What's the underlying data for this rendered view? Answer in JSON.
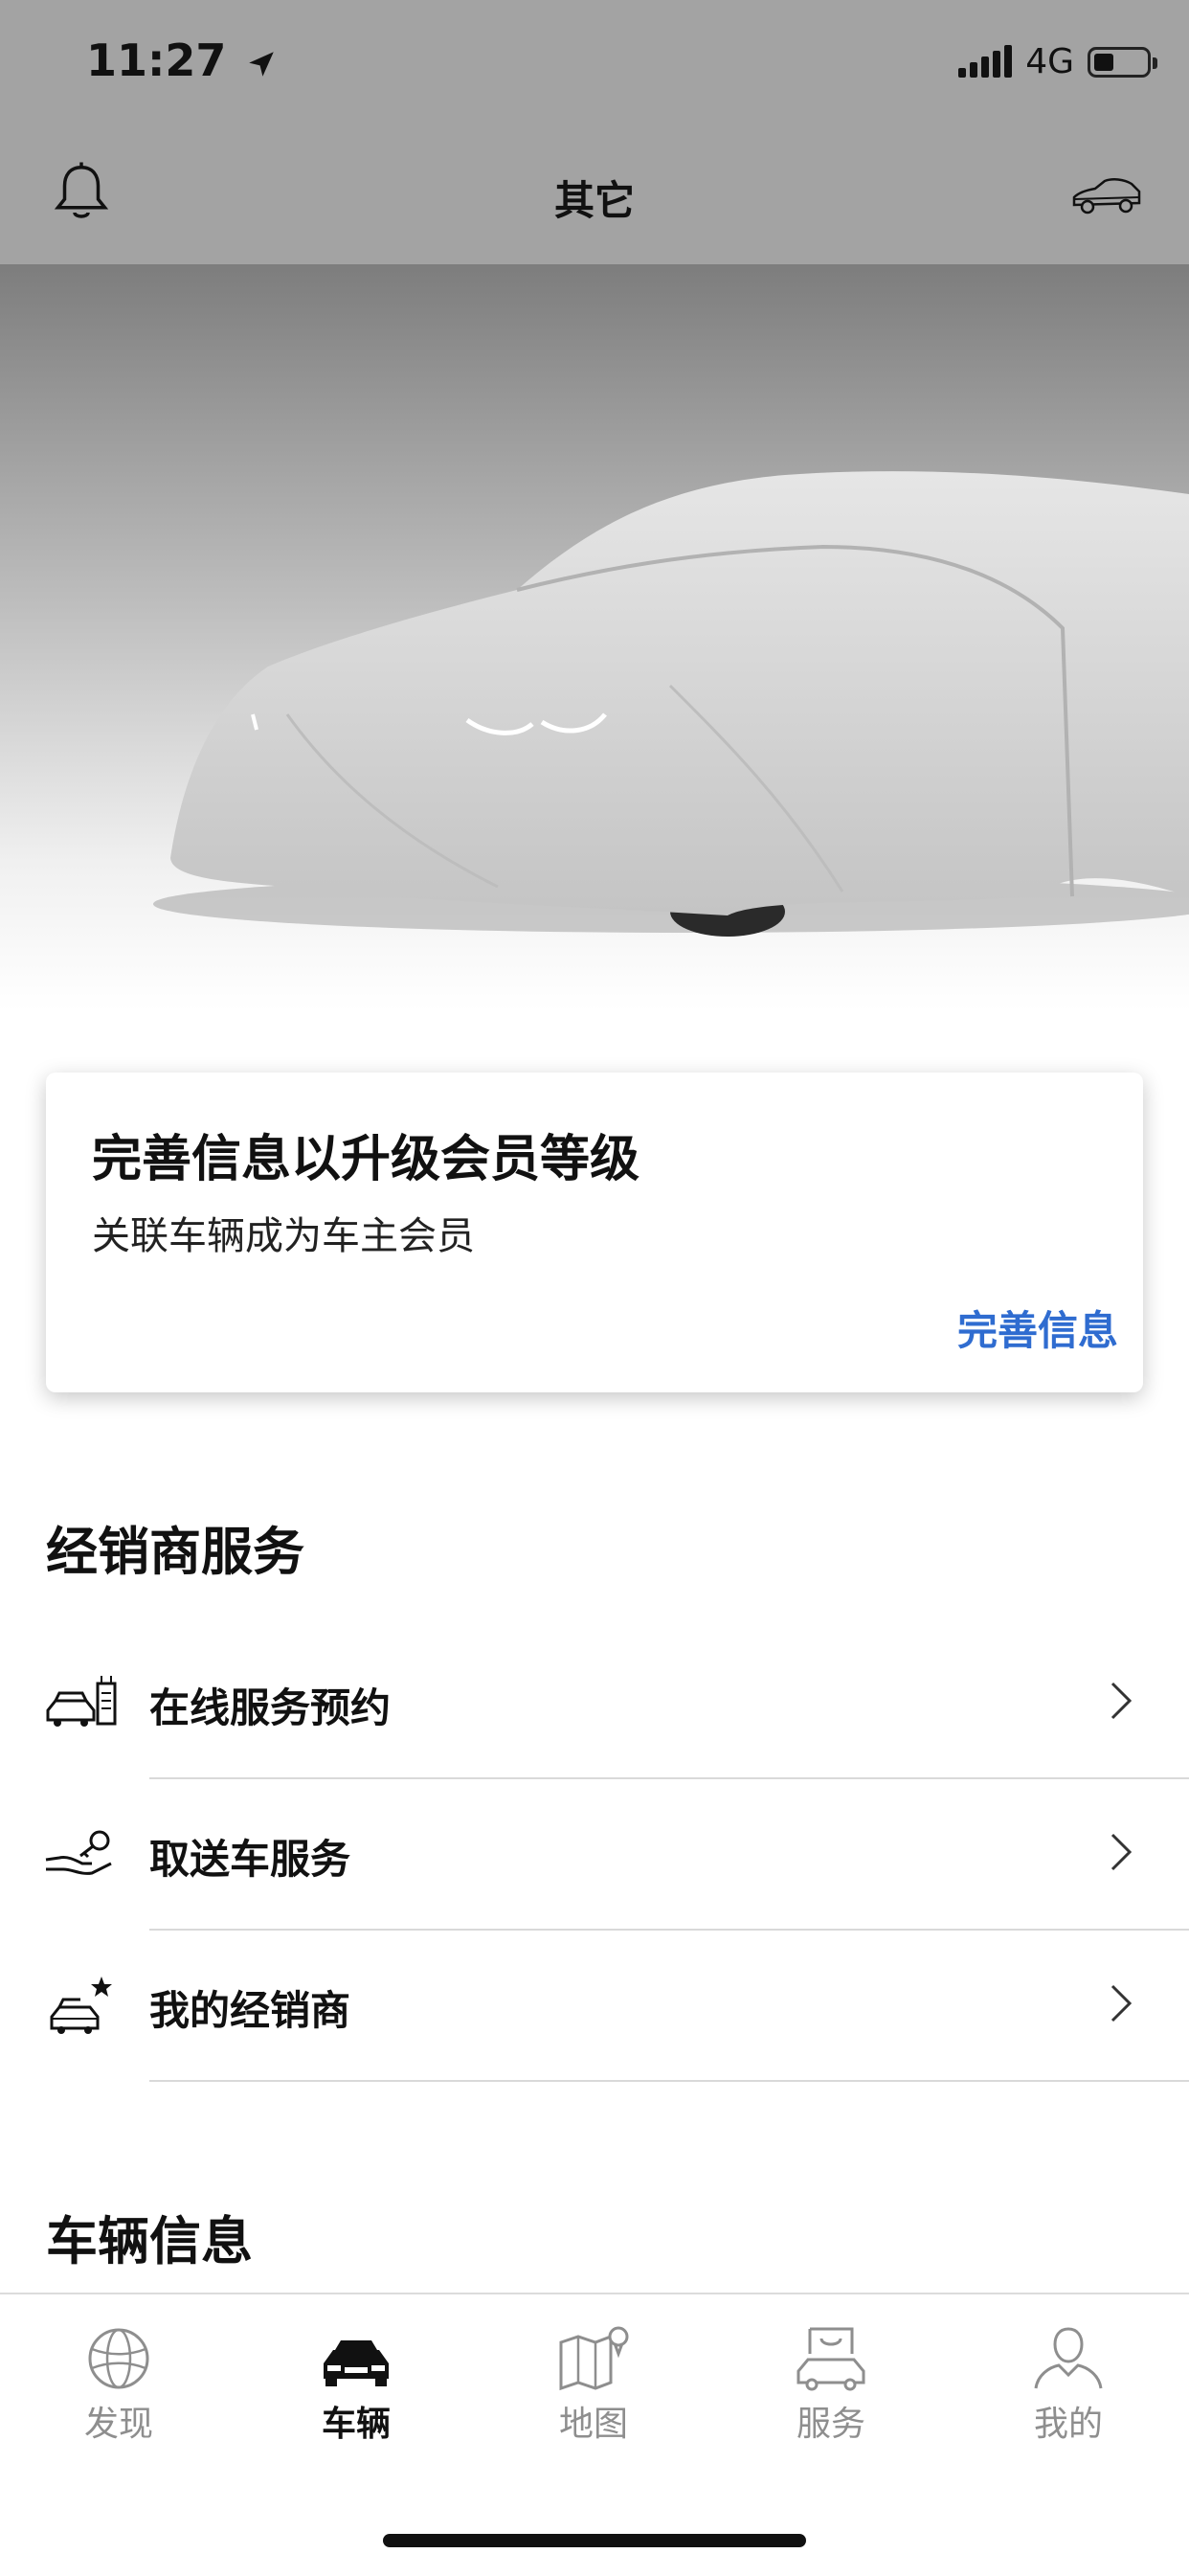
{
  "status_bar": {
    "time": "11:27",
    "network": "4G"
  },
  "header": {
    "title": "其它"
  },
  "card": {
    "title": "完善信息以升级会员等级",
    "subtitle": "关联车辆成为车主会员",
    "link": "完善信息",
    "link_color": "#2f6cd0"
  },
  "dealer_section": {
    "title": "经销商服务",
    "items": [
      {
        "label": "在线服务预约",
        "icon": "car-calendar-icon"
      },
      {
        "label": "取送车服务",
        "icon": "hand-key-icon"
      },
      {
        "label": "我的经销商",
        "icon": "car-star-icon"
      }
    ]
  },
  "vehicle_section": {
    "title": "车辆信息"
  },
  "tabs": [
    {
      "label": "发现",
      "icon": "globe-icon",
      "active": false
    },
    {
      "label": "车辆",
      "icon": "car-icon",
      "active": true
    },
    {
      "label": "地图",
      "icon": "map-icon",
      "active": false
    },
    {
      "label": "服务",
      "icon": "shopping-car-icon",
      "active": false
    },
    {
      "label": "我的",
      "icon": "person-icon",
      "active": false
    }
  ]
}
